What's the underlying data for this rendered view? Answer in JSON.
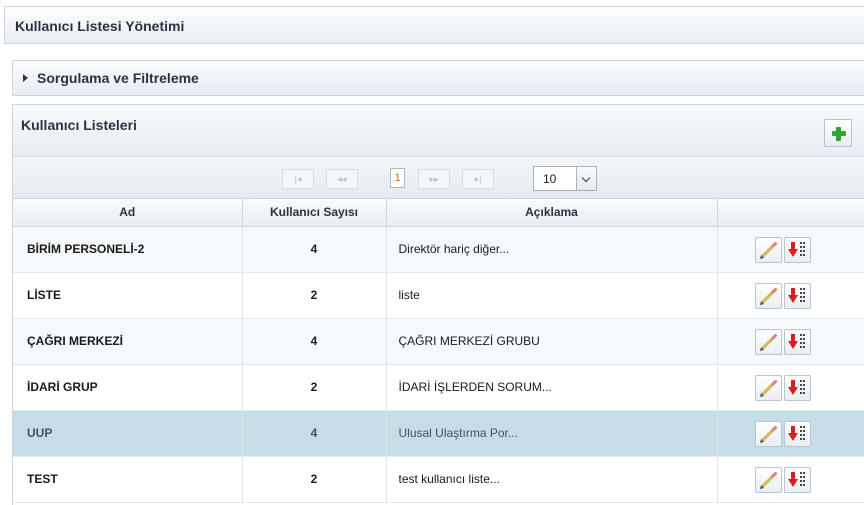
{
  "header": {
    "title": "Kullanıcı Listesi Yönetimi"
  },
  "filter": {
    "title": "Sorgulama ve Filtreleme"
  },
  "list": {
    "title": "Kullanıcı Listeleri",
    "pager": {
      "first": "|◂",
      "prev": "◂◂",
      "current_page": "1",
      "next": "▸▸",
      "last": "▸|",
      "page_size": "10"
    },
    "columns": [
      "Ad",
      "Kullanıcı Sayısı",
      "Açıklama",
      ""
    ],
    "rows": [
      {
        "name": "BİRİM PERSONELİ-2",
        "count": "4",
        "desc": "Direktör hariç diğer..."
      },
      {
        "name": "LİSTE",
        "count": "2",
        "desc": "liste"
      },
      {
        "name": "ÇAĞRI MERKEZİ",
        "count": "4",
        "desc": "ÇAĞRI MERKEZİ GRUBU"
      },
      {
        "name": "İDARİ GRUP",
        "count": "2",
        "desc": "İDARİ İŞLERDEN SORUM..."
      },
      {
        "name": "UUP",
        "count": "4",
        "desc": "Ulusal Ulaştırma Por..."
      },
      {
        "name": "TEST",
        "count": "2",
        "desc": "test kullanıcı liste..."
      }
    ],
    "selected_row": 4,
    "icons": {
      "add": "plus-icon",
      "edit": "pencil-icon",
      "remove": "delete-user-icon"
    }
  },
  "colors": {
    "accent_green": "#2fa52f",
    "remove_red": "#d42020",
    "selected_row": "#c4dde6",
    "pager_current": "#d9700a"
  }
}
